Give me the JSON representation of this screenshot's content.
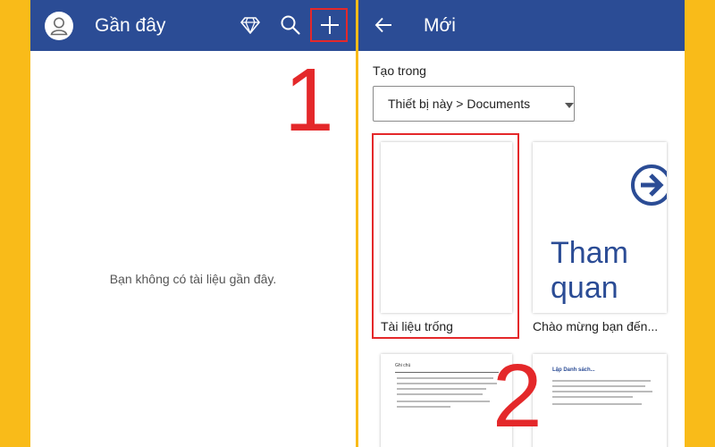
{
  "left_panel": {
    "title": "Gần đây",
    "empty_message": "Bạn không có tài liệu gần đây.",
    "icons": [
      "avatar-icon",
      "diamond-icon",
      "search-icon",
      "plus-icon"
    ]
  },
  "right_panel": {
    "title": "Mới",
    "section_label": "Tạo trong",
    "location_value": "Thiết bị này > Documents",
    "templates": [
      {
        "label": "Tài liệu trống"
      },
      {
        "label": "Chào mừng bạn đến...",
        "thumb_text": "Tham quan"
      },
      {
        "mini_title": "Ghi chú"
      },
      {
        "mini_title": "Lập Danh sách..."
      }
    ]
  },
  "annotations": {
    "step1": "1",
    "step2": "2"
  },
  "colors": {
    "background": "#F9BB19",
    "appbar": "#2B4C95",
    "highlight": "#E4282A",
    "panel": "#FFFFFF"
  }
}
